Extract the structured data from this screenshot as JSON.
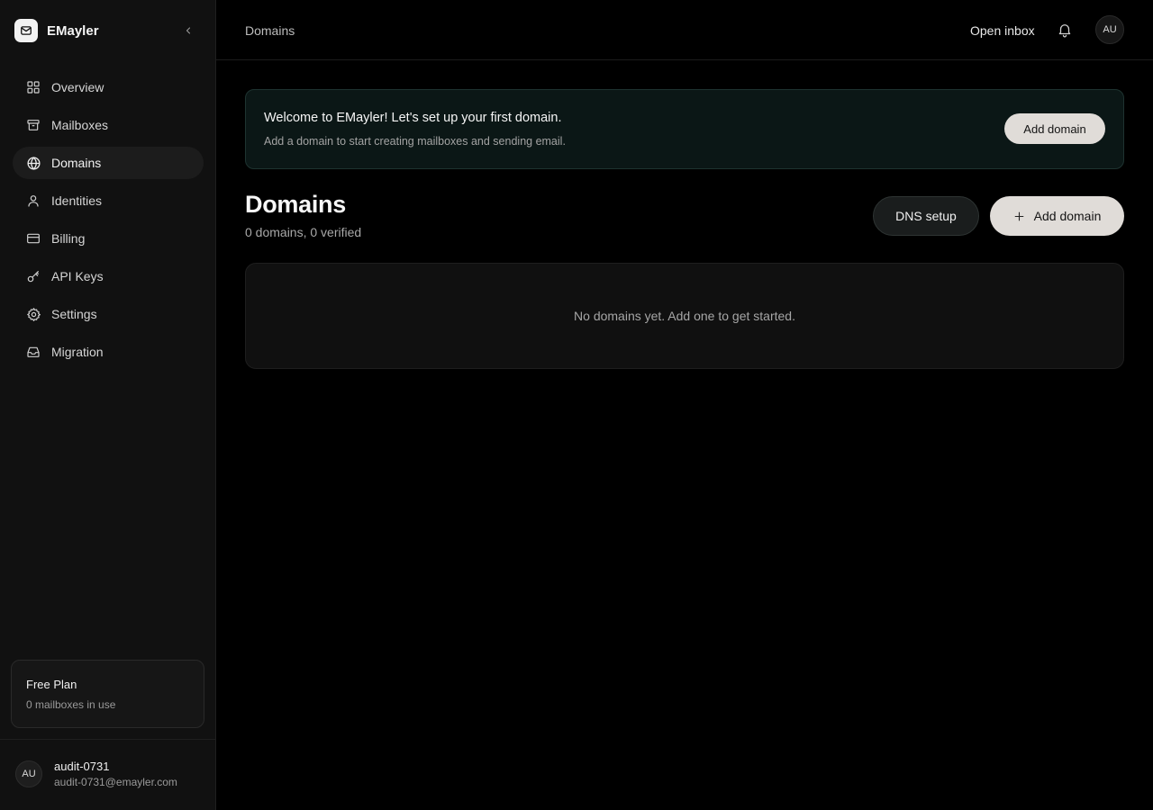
{
  "app": {
    "name": "EMayler"
  },
  "sidebar": {
    "items": [
      {
        "label": "Overview",
        "icon": "grid-icon"
      },
      {
        "label": "Mailboxes",
        "icon": "archive-icon"
      },
      {
        "label": "Domains",
        "icon": "globe-icon",
        "active": true
      },
      {
        "label": "Identities",
        "icon": "user-icon"
      },
      {
        "label": "Billing",
        "icon": "credit-card-icon"
      },
      {
        "label": "API Keys",
        "icon": "key-icon"
      },
      {
        "label": "Settings",
        "icon": "gear-icon"
      },
      {
        "label": "Migration",
        "icon": "inbox-icon"
      }
    ],
    "plan": {
      "title": "Free Plan",
      "subtitle": "0 mailboxes in use"
    },
    "user": {
      "initials": "AU",
      "name": "audit-0731",
      "email": "audit-0731@emayler.com"
    }
  },
  "header": {
    "breadcrumb": "Domains",
    "open_inbox": "Open inbox",
    "avatar_initials": "AU"
  },
  "welcome": {
    "title": "Welcome to EMayler! Let's set up your first domain.",
    "subtitle": "Add a domain to start creating mailboxes and sending email.",
    "button": "Add domain"
  },
  "main": {
    "title": "Domains",
    "subtitle": "0 domains, 0 verified",
    "dns_button": "DNS setup",
    "add_button": "Add domain",
    "empty_text": "No domains yet. Add one to get started."
  },
  "colors": {
    "background": "#000000",
    "sidebar": "#111111",
    "banner_bg": "#0b1716",
    "banner_border": "#1e3330",
    "primary_button": "#e0dcd8"
  }
}
